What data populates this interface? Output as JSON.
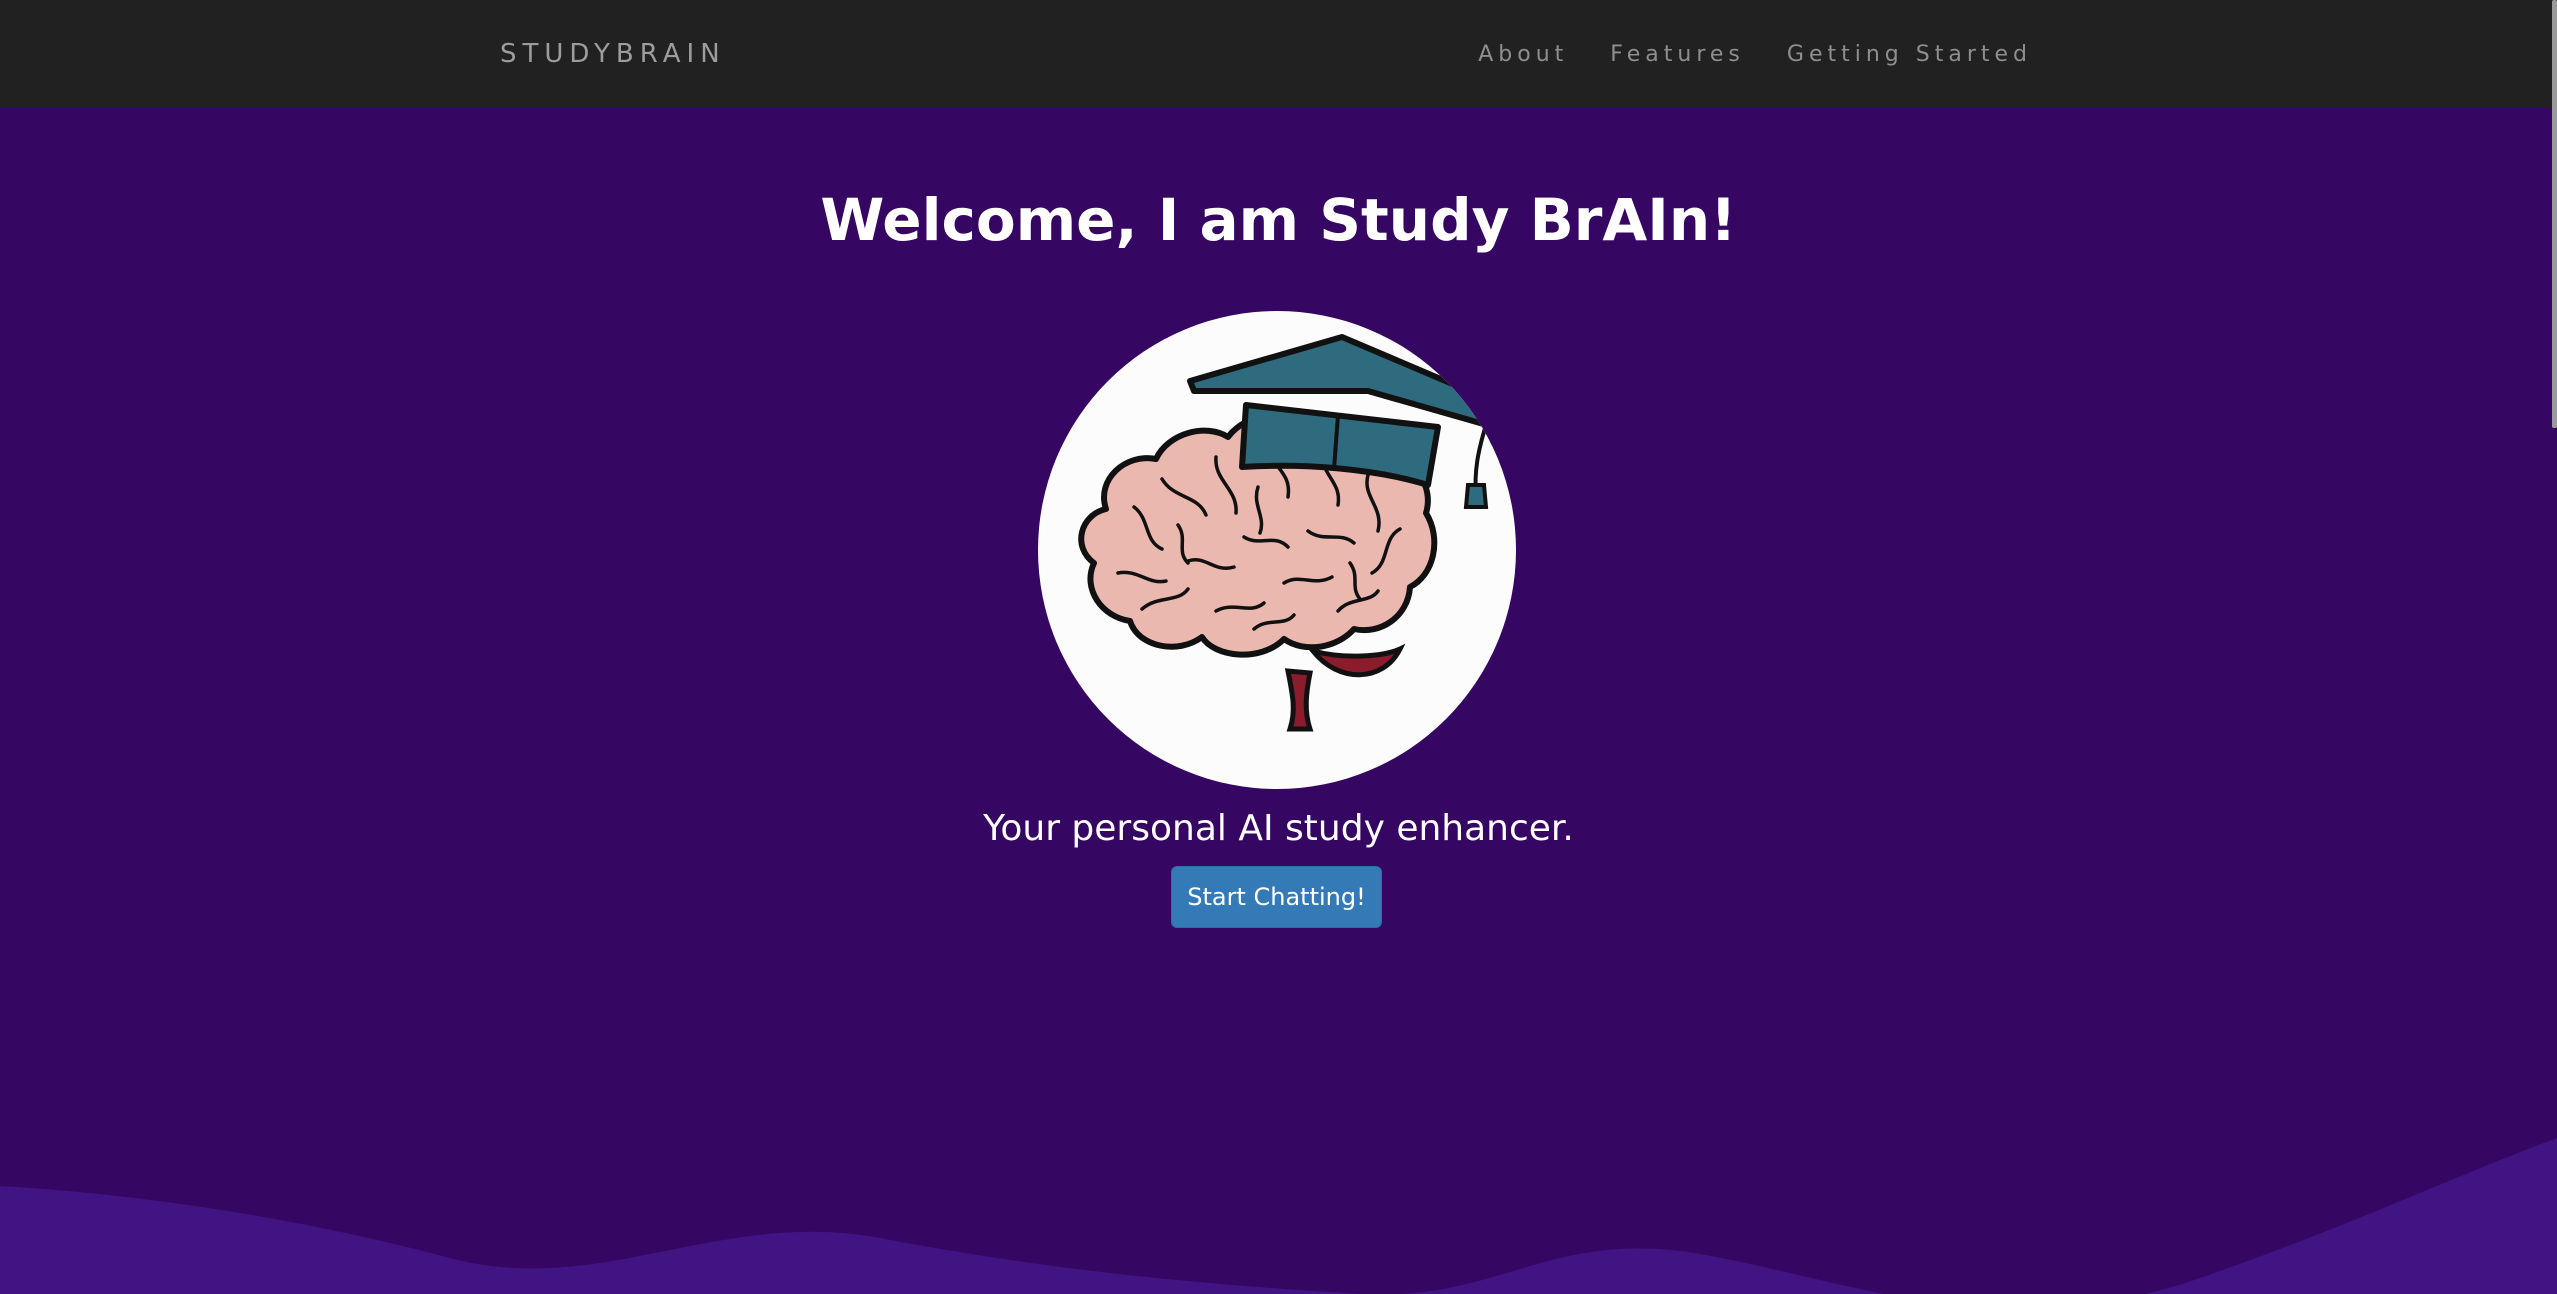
{
  "navbar": {
    "brand": "STUDYBRAIN",
    "links": [
      {
        "label": "About"
      },
      {
        "label": "Features"
      },
      {
        "label": "Getting Started"
      }
    ]
  },
  "hero": {
    "title": "Welcome, I am Study BrAIn!",
    "logo_icon": "brain-with-graduation-cap-icon",
    "tagline": "Your personal AI study enhancer.",
    "cta_label": "Start Chatting!"
  },
  "colors": {
    "navbar_bg": "#222121",
    "hero_bg": "#350763",
    "wave": "#411483",
    "button": "#337ab7",
    "text": "#ffffff",
    "nav_text": "#9d9d9d"
  }
}
